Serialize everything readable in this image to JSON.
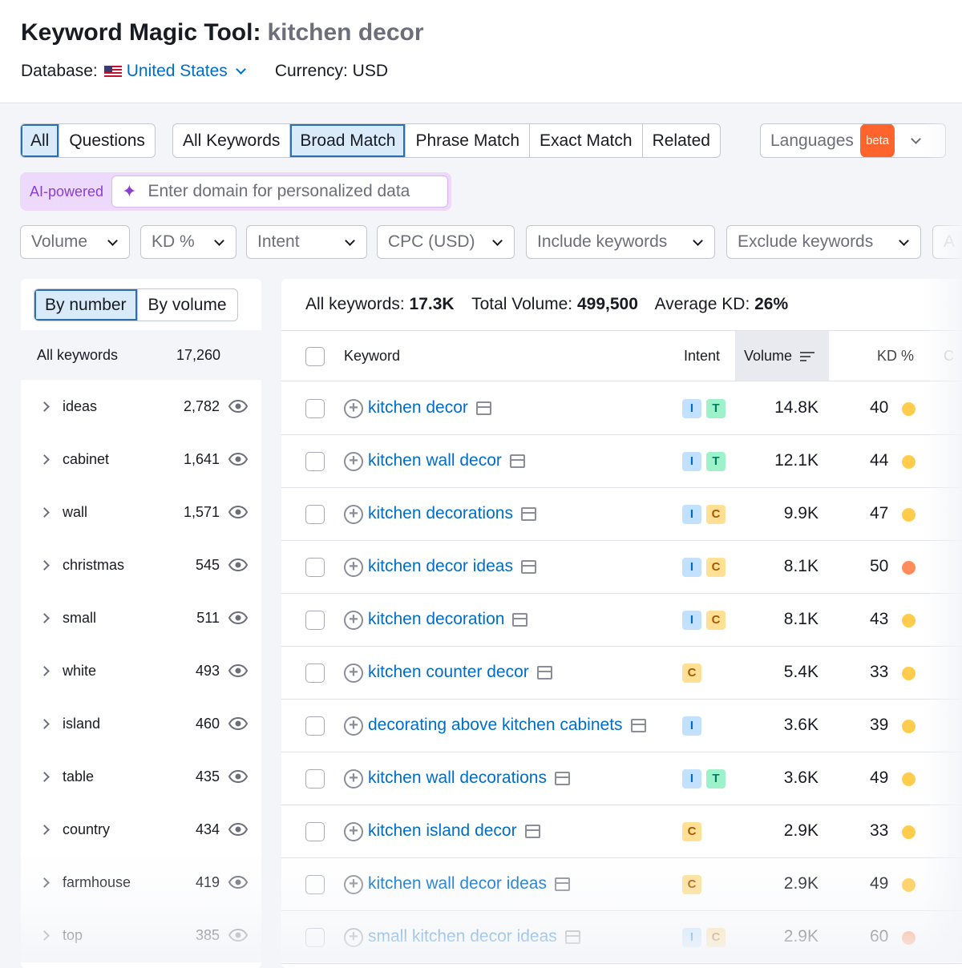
{
  "header": {
    "title": "Keyword Magic Tool:",
    "query": "kitchen decor",
    "database_label": "Database:",
    "database_value": "United States",
    "currency": "Currency: USD"
  },
  "tabs_type": [
    {
      "label": "All",
      "active": true
    },
    {
      "label": "Questions",
      "active": false
    }
  ],
  "tabs_match": [
    {
      "label": "All Keywords",
      "active": false
    },
    {
      "label": "Broad Match",
      "active": true
    },
    {
      "label": "Phrase Match",
      "active": false
    },
    {
      "label": "Exact Match",
      "active": false
    },
    {
      "label": "Related",
      "active": false
    }
  ],
  "languages": {
    "label": "Languages",
    "badge": "beta"
  },
  "ai": {
    "label": "AI-powered",
    "placeholder": "Enter domain for personalized data"
  },
  "filters": [
    "Volume",
    "KD %",
    "Intent",
    "CPC (USD)",
    "Include keywords",
    "Exclude keywords",
    "A"
  ],
  "sidebar": {
    "toggle": [
      "By number",
      "By volume"
    ],
    "active_toggle": "By number",
    "all_label": "All keywords",
    "all_count": "17,260",
    "groups": [
      {
        "name": "ideas",
        "count": "2,782"
      },
      {
        "name": "cabinet",
        "count": "1,641"
      },
      {
        "name": "wall",
        "count": "1,571"
      },
      {
        "name": "christmas",
        "count": "545"
      },
      {
        "name": "small",
        "count": "511"
      },
      {
        "name": "white",
        "count": "493"
      },
      {
        "name": "island",
        "count": "460"
      },
      {
        "name": "table",
        "count": "435"
      },
      {
        "name": "country",
        "count": "434"
      },
      {
        "name": "farmhouse",
        "count": "419"
      },
      {
        "name": "top",
        "count": "385"
      }
    ]
  },
  "stats": {
    "all_label": "All keywords:",
    "all_value": "17.3K",
    "volume_label": "Total Volume:",
    "volume_value": "499,500",
    "kd_label": "Average KD:",
    "kd_value": "26%"
  },
  "table": {
    "columns": [
      "Keyword",
      "Intent",
      "Volume",
      "KD %",
      "C"
    ],
    "rows": [
      {
        "keyword": "kitchen decor",
        "intent": [
          "I",
          "T"
        ],
        "volume": "14.8K",
        "kd": "40",
        "kd_color": "#ffcc4d"
      },
      {
        "keyword": "kitchen wall decor",
        "intent": [
          "I",
          "T"
        ],
        "volume": "12.1K",
        "kd": "44",
        "kd_color": "#ffcc4d"
      },
      {
        "keyword": "kitchen decorations",
        "intent": [
          "I",
          "C"
        ],
        "volume": "9.9K",
        "kd": "47",
        "kd_color": "#ffcc4d"
      },
      {
        "keyword": "kitchen decor ideas",
        "intent": [
          "I",
          "C"
        ],
        "volume": "8.1K",
        "kd": "50",
        "kd_color": "#ff8c5a"
      },
      {
        "keyword": "kitchen decoration",
        "intent": [
          "I",
          "C"
        ],
        "volume": "8.1K",
        "kd": "43",
        "kd_color": "#ffcc4d"
      },
      {
        "keyword": "kitchen counter decor",
        "intent": [
          "C"
        ],
        "volume": "5.4K",
        "kd": "33",
        "kd_color": "#ffcc4d"
      },
      {
        "keyword": "decorating above kitchen cabinets",
        "intent": [
          "I"
        ],
        "volume": "3.6K",
        "kd": "39",
        "kd_color": "#ffcc4d"
      },
      {
        "keyword": "kitchen wall decorations",
        "intent": [
          "I",
          "T"
        ],
        "volume": "3.6K",
        "kd": "49",
        "kd_color": "#ffcc4d"
      },
      {
        "keyword": "kitchen island decor",
        "intent": [
          "C"
        ],
        "volume": "2.9K",
        "kd": "33",
        "kd_color": "#ffcc4d"
      },
      {
        "keyword": "kitchen wall decor ideas",
        "intent": [
          "C"
        ],
        "volume": "2.9K",
        "kd": "49",
        "kd_color": "#ffcc4d"
      },
      {
        "keyword": "small kitchen decor ideas",
        "intent": [
          "I",
          "C"
        ],
        "volume": "2.9K",
        "kd": "60",
        "kd_color": "#ff8c5a"
      }
    ]
  }
}
